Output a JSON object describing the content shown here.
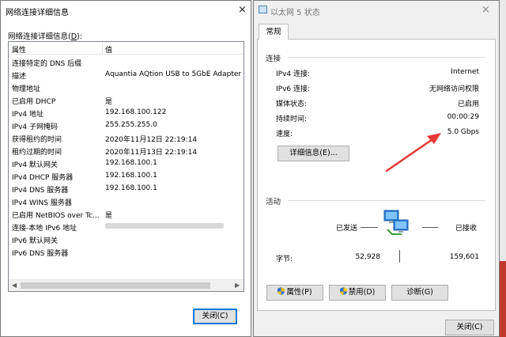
{
  "left_window": {
    "title": "网络连接详细信息",
    "close_glyph": "×",
    "details_label_prefix": "网络连接详细信息(",
    "details_label_key": "D",
    "details_label_suffix": "):",
    "columns": {
      "property": "属性",
      "value": "值"
    },
    "rows": [
      {
        "k": "连接特定的 DNS 后缀",
        "v": ""
      },
      {
        "k": "描述",
        "v": "Aquantia AQtion USB to 5GbE Adapter"
      },
      {
        "k": "物理地址",
        "v": ""
      },
      {
        "k": "已启用 DHCP",
        "v": "是"
      },
      {
        "k": "IPv4 地址",
        "v": "192.168.100.122"
      },
      {
        "k": "IPv4 子网掩码",
        "v": "255.255.255.0"
      },
      {
        "k": "获得租约的时间",
        "v": "2020年11月12日 22:19:14"
      },
      {
        "k": "租约过期的时间",
        "v": "2020年11月13日 22:19:14"
      },
      {
        "k": "IPv4 默认网关",
        "v": "192.168.100.1"
      },
      {
        "k": "IPv4 DHCP 服务器",
        "v": "192.168.100.1"
      },
      {
        "k": "IPv4 DNS 服务器",
        "v": "192.168.100.1"
      },
      {
        "k": "IPv4 WINS 服务器",
        "v": ""
      },
      {
        "k": "已启用 NetBIOS over Tc...",
        "v": "是"
      },
      {
        "k": "连接-本地 IPv6 地址",
        "v": ""
      },
      {
        "k": "IPv6 默认网关",
        "v": ""
      },
      {
        "k": "IPv6 DNS 服务器",
        "v": ""
      }
    ],
    "close_button": "关闭(C)"
  },
  "right_window": {
    "title": "以太网 5 状态",
    "close_glyph": "×",
    "tab": "常规",
    "connection": {
      "group": "连接",
      "items": [
        {
          "k": "IPv4 连接:",
          "v": "Internet"
        },
        {
          "k": "IPv6 连接:",
          "v": "无网络访问权限"
        },
        {
          "k": "媒体状态:",
          "v": "已启用"
        },
        {
          "k": "持续时间:",
          "v": "00:00:29"
        },
        {
          "k": "速度:",
          "v": "5.0 Gbps"
        }
      ],
      "details_button": "详细信息(E)..."
    },
    "activity": {
      "group": "活动",
      "sent_label": "已发送",
      "received_label": "已接收",
      "bytes_label": "字节:",
      "sent_value": "52,928",
      "received_value": "159,601"
    },
    "buttons": {
      "properties": "属性(P)",
      "disable": "禁用(D)",
      "diagnose": "诊断(G)",
      "close": "关闭(C)"
    }
  },
  "colors": {
    "annotation_arrow": "#e53935",
    "accent_border": "#0078d7"
  }
}
